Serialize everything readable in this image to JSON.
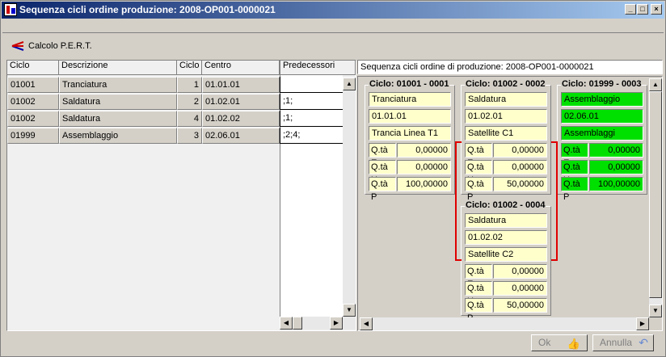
{
  "window": {
    "title": "Sequenza cicli ordine produzione: 2008-OP001-0000021",
    "minimize": "_",
    "maximize": "□",
    "close": "×"
  },
  "toolbar": {
    "pert_label": "Calcolo P.E.R.T."
  },
  "grid": {
    "headers": {
      "ciclo": "Ciclo",
      "descrizione": "Descrizione",
      "ciclo_num": "Ciclo",
      "centro": "Centro",
      "predecessori": "Predecessori"
    },
    "rows": [
      {
        "ciclo": "01001",
        "descrizione": "Tranciatura",
        "num": "1",
        "centro": "01.01.01",
        "pred": ""
      },
      {
        "ciclo": "01002",
        "descrizione": "Saldatura",
        "num": "2",
        "centro": "01.02.01",
        "pred": ";1;"
      },
      {
        "ciclo": "01002",
        "descrizione": "Saldatura",
        "num": "4",
        "centro": "01.02.02",
        "pred": ";1;"
      },
      {
        "ciclo": "01999",
        "descrizione": "Assemblaggio",
        "num": "3",
        "centro": "02.06.01",
        "pred": ";2;4;"
      }
    ]
  },
  "sequence": {
    "caption": "Sequenza cicli ordine di produzione: 2008-OP001-0000021",
    "cards": [
      {
        "title": "Ciclo: 01001 - 0001",
        "desc": "Tranciatura",
        "centro": "01.01.01",
        "macchina": "Trancia Linea T1",
        "qe_label": "Q.tà E",
        "qe": "0,00000",
        "qu_label": "Q.tà U",
        "qu": "0,00000",
        "qp_label": "Q.tà P",
        "qp": "100,00000"
      },
      {
        "title": "Ciclo: 01002 - 0002",
        "desc": "Saldatura",
        "centro": "01.02.01",
        "macchina": "Satellite C1",
        "qe_label": "Q.tà E",
        "qe": "0,00000",
        "qu_label": "Q.tà U",
        "qu": "0,00000",
        "qp_label": "Q.tà P",
        "qp": "50,00000"
      },
      {
        "title": "Ciclo: 01999 - 0003",
        "desc": "Assemblaggio",
        "centro": "02.06.01",
        "macchina": "Assemblaggi",
        "qe_label": "Q.tà E",
        "qe": "0,00000",
        "qu_label": "Q.tà U",
        "qu": "0,00000",
        "qp_label": "Q.tà P",
        "qp": "100,00000",
        "highlight": "#00e000"
      },
      {
        "title": "Ciclo: 01002 - 0004",
        "desc": "Saldatura",
        "centro": "01.02.02",
        "macchina": "Satellite C2",
        "qe_label": "Q.tà E",
        "qe": "0,00000",
        "qu_label": "Q.tà U",
        "qu": "0,00000",
        "qp_label": "Q.tà P",
        "qp": "50,00000"
      }
    ]
  },
  "footer": {
    "ok_label": "Ok",
    "annulla_label": "Annulla"
  }
}
